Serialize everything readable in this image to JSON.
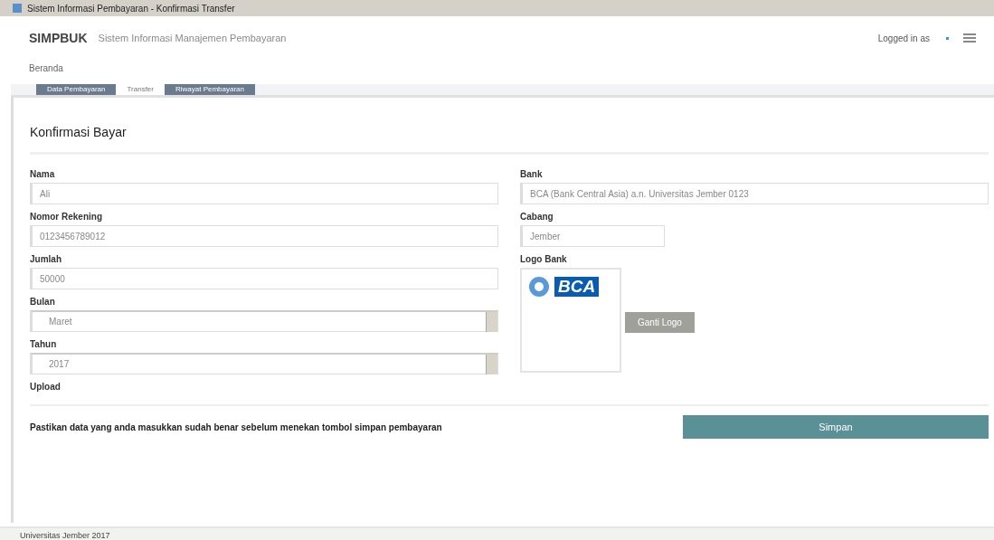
{
  "window": {
    "title": "Sistem Informasi Pembayaran - Konfirmasi Transfer"
  },
  "header": {
    "logo": "SIMPBUK",
    "subtitle": "Sistem Informasi Manajemen Pembayaran",
    "user": "Logged in as"
  },
  "breadcrumb": "Beranda",
  "tabs": [
    {
      "label": "Data Pembayaran",
      "selected": false
    },
    {
      "label": "Transfer",
      "selected": true
    },
    {
      "label": "Riwayat Pembayaran",
      "selected": false
    }
  ],
  "section_title": "Konfirmasi Bayar",
  "left_fields": [
    {
      "kind": "text",
      "label": "Nama",
      "value": "Ali"
    },
    {
      "kind": "text",
      "label": "Nomor Rekening",
      "value": "0123456789012"
    },
    {
      "kind": "text",
      "label": "Jumlah",
      "value": "50000"
    },
    {
      "kind": "select",
      "label": "Bulan",
      "value": "Maret"
    },
    {
      "kind": "select",
      "label": "Tahun",
      "value": "2017"
    }
  ],
  "upload_label": "Upload",
  "right_fields": [
    {
      "kind": "text",
      "label": "Bank",
      "value": "BCA (Bank Central Asia) a.n. Universitas Jember 0123"
    },
    {
      "kind": "text",
      "label": "Cabang",
      "value": "Jember"
    }
  ],
  "logo_label": "Logo Bank",
  "logo_text": "BCA",
  "change_button": "Ganti Logo",
  "note": "Pastikan data yang anda masukkan sudah benar sebelum menekan tombol simpan pembayaran",
  "submit_button": "Simpan",
  "footer": "Universitas Jember 2017"
}
